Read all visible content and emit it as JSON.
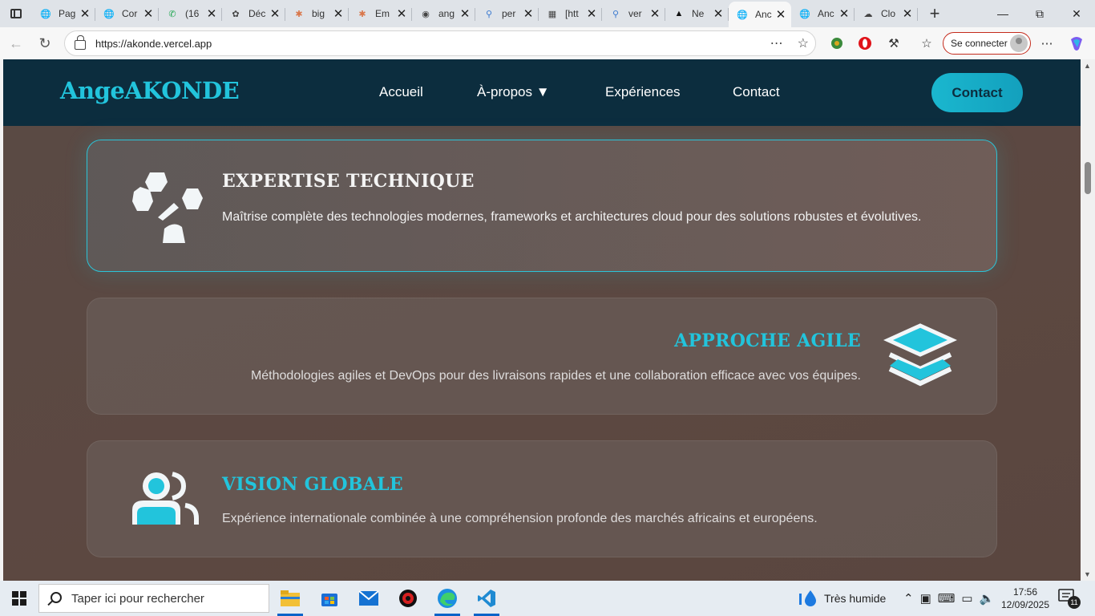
{
  "browser": {
    "tabs": [
      {
        "label": "Pag",
        "icon": "globe-icon"
      },
      {
        "label": "Cor",
        "icon": "globe-icon"
      },
      {
        "label": "(16",
        "icon": "whatsapp-icon"
      },
      {
        "label": "Déc",
        "icon": "openai-icon"
      },
      {
        "label": "big",
        "icon": "claude-icon"
      },
      {
        "label": "Em",
        "icon": "claude-icon"
      },
      {
        "label": "ang",
        "icon": "github-icon"
      },
      {
        "label": "per",
        "icon": "search-icon"
      },
      {
        "label": "[htt",
        "icon": "image-icon"
      },
      {
        "label": "ver",
        "icon": "search-icon"
      },
      {
        "label": "Ne",
        "icon": "vercel-icon"
      },
      {
        "label": "Anc",
        "icon": "globe-icon",
        "active": true
      },
      {
        "label": "Anc",
        "icon": "globe-icon"
      },
      {
        "label": "Clo",
        "icon": "cloud-icon"
      }
    ],
    "url": "https://akonde.vercel.app",
    "signin_label": "Se connecter"
  },
  "site": {
    "logo": "AngeAKONDE",
    "nav": {
      "home": "Accueil",
      "about": "À-propos ▼",
      "experiences": "Expériences",
      "contact": "Contact"
    },
    "cta": "Contact",
    "cards": [
      {
        "title": "EXPERTISE TECHNIQUE",
        "description": "Maîtrise complète des technologies modernes, frameworks et architectures cloud pour des solutions robustes et évolutives.",
        "icon": "network-nodes-icon"
      },
      {
        "title": "APPROCHE AGILE",
        "description": "Méthodologies agiles et DevOps pour des livraisons rapides et une collaboration efficace avec vos équipes.",
        "icon": "layers-icon"
      },
      {
        "title": "VISION GLOBALE",
        "description": "Expérience internationale combinée à une compréhension profonde des marchés africains et européens.",
        "icon": "users-icon"
      }
    ],
    "colors": {
      "nav_bg": "#0c2d3e",
      "accent": "#22c4dc",
      "page_bg": "#5a4a45"
    }
  },
  "taskbar": {
    "search_placeholder": "Taper ici pour rechercher",
    "weather": "Très humide",
    "time": "17:56",
    "date": "12/09/2025",
    "notifications": "11"
  }
}
